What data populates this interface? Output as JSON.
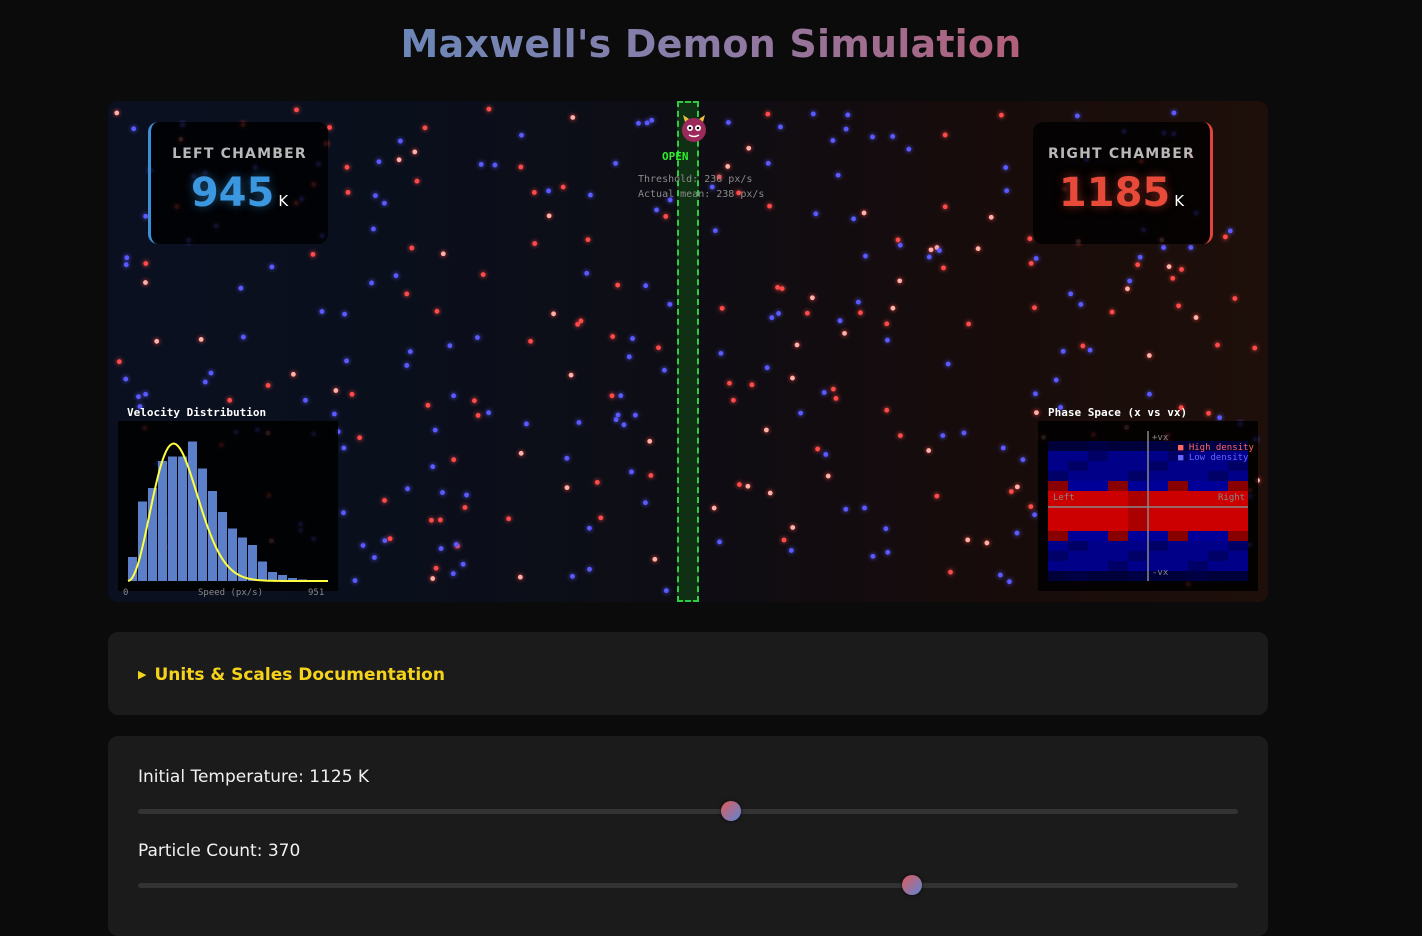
{
  "page": {
    "title": "Maxwell's Demon Simulation"
  },
  "simulation": {
    "left_chamber": {
      "label": "LEFT CHAMBER",
      "value": "945",
      "unit": "K",
      "color": "#3a97e0"
    },
    "right_chamber": {
      "label": "RIGHT CHAMBER",
      "value": "1185",
      "unit": "K",
      "color": "#e84a3a"
    },
    "gate": {
      "status": "OPEN",
      "threshold_text": "Threshold: 236 px/s",
      "mean_text": "Actual mean: 238 px/s",
      "demon_icon": "demon-face-icon",
      "color": "#2ecc40"
    },
    "particle_colors": {
      "fast": "#ff4a4a",
      "slow": "#5a5aff"
    }
  },
  "velocity_panel": {
    "title": "Velocity Distribution",
    "x_min_label": "0",
    "x_label": "Speed (px/s)",
    "x_max_label": "951",
    "histogram_relative": [
      0.16,
      0.53,
      0.62,
      0.8,
      0.83,
      0.83,
      0.93,
      0.75,
      0.6,
      0.46,
      0.35,
      0.29,
      0.24,
      0.13,
      0.06,
      0.04,
      0.02,
      0.01,
      0.0,
      0.0
    ],
    "bar_color": "#5b7fc9",
    "curve_color": "#ffff40"
  },
  "phase_panel": {
    "title": "Phase Space (x vs vx)",
    "top_label": "+vx",
    "bottom_label": "-vx",
    "left_label": "Left",
    "right_label": "Right",
    "legend": [
      {
        "label": "High density",
        "color": "#ff5555"
      },
      {
        "label": "Low density",
        "color": "#5555ff"
      }
    ]
  },
  "docs": {
    "summary": "Units & Scales Documentation"
  },
  "controls": {
    "temperature": {
      "label": "Initial Temperature: 1125 K",
      "fraction": 0.54
    },
    "particle_count": {
      "label": "Particle Count: 370",
      "fraction": 0.707
    }
  }
}
